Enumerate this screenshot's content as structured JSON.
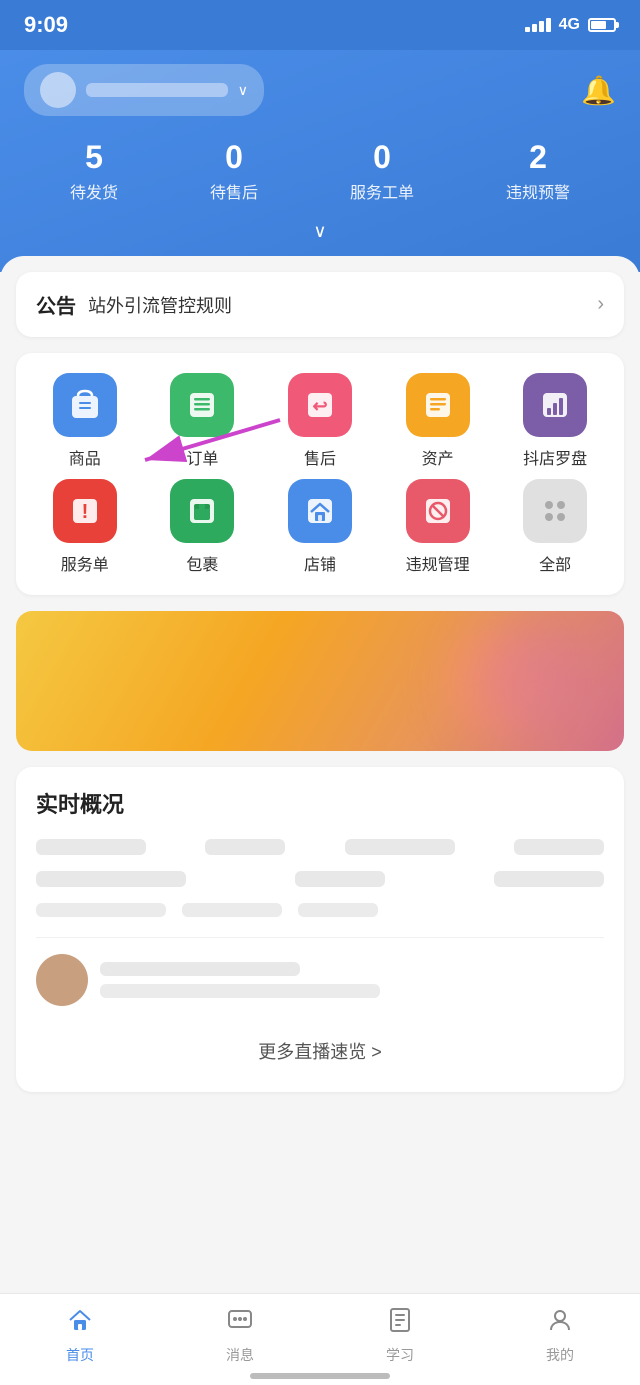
{
  "statusBar": {
    "time": "9:09",
    "network": "4G"
  },
  "header": {
    "shopName": "",
    "bellLabel": "通知",
    "stats": [
      {
        "key": "pending_ship",
        "number": "5",
        "label": "待发货"
      },
      {
        "key": "pending_after",
        "number": "0",
        "label": "待售后"
      },
      {
        "key": "service",
        "number": "0",
        "label": "服务工单"
      },
      {
        "key": "violation",
        "number": "2",
        "label": "违规预警"
      }
    ],
    "chevronLabel": "∨"
  },
  "announcement": {
    "label": "公告",
    "text": "站外引流管控规则",
    "arrow": ">"
  },
  "menuItems": [
    {
      "id": "product",
      "icon": "🛍",
      "label": "商品",
      "colorClass": "blue"
    },
    {
      "id": "order",
      "icon": "☰",
      "label": "订单",
      "colorClass": "green"
    },
    {
      "id": "aftersale",
      "icon": "↩",
      "label": "售后",
      "colorClass": "pink"
    },
    {
      "id": "asset",
      "icon": "📋",
      "label": "资产",
      "colorClass": "orange"
    },
    {
      "id": "compass",
      "icon": "📊",
      "label": "抖店罗盘",
      "colorClass": "purple"
    },
    {
      "id": "service_order",
      "icon": "!",
      "label": "服务单",
      "colorClass": "red"
    },
    {
      "id": "package",
      "icon": "📦",
      "label": "包裹",
      "colorClass": "dark-green"
    },
    {
      "id": "shop",
      "icon": "🏠",
      "label": "店铺",
      "colorClass": "blue2"
    },
    {
      "id": "violation_mgmt",
      "icon": "⊘",
      "label": "违规管理",
      "colorClass": "red2"
    },
    {
      "id": "all",
      "icon": "⋮⋮",
      "label": "全部",
      "colorClass": "gray"
    }
  ],
  "realtime": {
    "title": "实时概况",
    "moreLive": "更多直播速览 >"
  },
  "bottomNav": [
    {
      "id": "home",
      "icon": "⌂",
      "label": "首页",
      "active": true
    },
    {
      "id": "message",
      "icon": "💬",
      "label": "消息",
      "active": false
    },
    {
      "id": "learn",
      "icon": "📖",
      "label": "学习",
      "active": false
    },
    {
      "id": "mine",
      "icon": "👤",
      "label": "我的",
      "active": false
    }
  ]
}
